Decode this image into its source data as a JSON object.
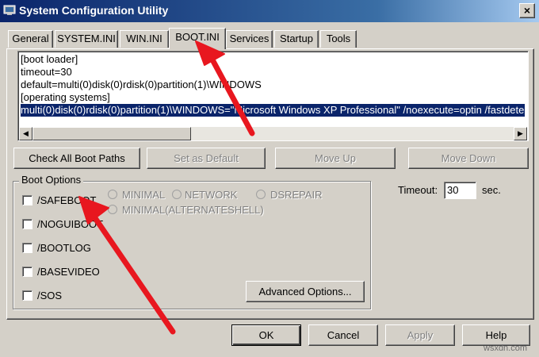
{
  "window": {
    "title": "System Configuration Utility",
    "close_glyph": "×"
  },
  "tabs": [
    {
      "label": "General"
    },
    {
      "label": "SYSTEM.INI"
    },
    {
      "label": "WIN.INI"
    },
    {
      "label": "BOOT.INI",
      "active": true
    },
    {
      "label": "Services"
    },
    {
      "label": "Startup"
    },
    {
      "label": "Tools"
    }
  ],
  "boot_ini": {
    "lines": [
      "[boot loader]",
      "timeout=30",
      "default=multi(0)disk(0)rdisk(0)partition(1)\\WINDOWS",
      "[operating systems]",
      "multi(0)disk(0)rdisk(0)partition(1)\\WINDOWS=\"Microsoft Windows XP Professional\" /noexecute=optin /fastdetect"
    ],
    "selected_line": 4
  },
  "actions": {
    "check_paths": "Check All Boot Paths",
    "set_default": "Set as Default",
    "move_up": "Move Up",
    "move_down": "Move Down"
  },
  "boot_options": {
    "title": "Boot Options",
    "checkboxes": [
      "/SAFEBOOT",
      "/NOGUIBOOT",
      "/BOOTLOG",
      "/BASEVIDEO",
      "/SOS"
    ],
    "radios": [
      "MINIMAL",
      "NETWORK",
      "DSREPAIR",
      "MINIMAL(ALTERNATESHELL)"
    ],
    "advanced": "Advanced Options..."
  },
  "timeout": {
    "label": "Timeout:",
    "value": "30",
    "unit": "sec."
  },
  "footer": {
    "ok": "OK",
    "cancel": "Cancel",
    "apply": "Apply",
    "help": "Help"
  },
  "watermark": "wsxdn.com",
  "colors": {
    "title_gradient_start": "#0a246a",
    "selection": "#0a246a",
    "face": "#d4d0c8",
    "annotation_arrow": "#e8171f"
  },
  "icons": {
    "app": "app-icon",
    "close": "close-icon",
    "scroll_left": "arrow-left-icon",
    "scroll_right": "arrow-right-icon"
  }
}
